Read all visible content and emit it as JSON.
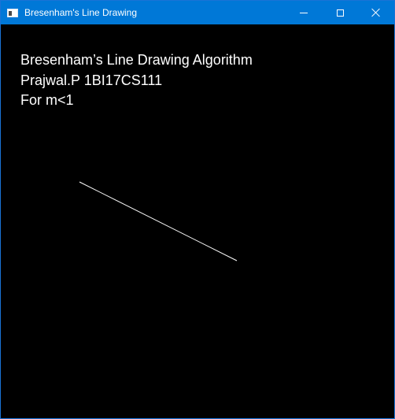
{
  "window": {
    "title": "Bresenham's Line Drawing",
    "titlebar_color": "#0078d7",
    "app_icon": "console-window-icon",
    "controls": {
      "minimize": "minimize-icon",
      "maximize": "maximize-icon",
      "close": "close-icon"
    }
  },
  "canvas": {
    "background": "#000000",
    "text_color": "#ffffff",
    "text_lines": [
      "Bresenham’s Line Drawing Algorithm",
      "Prajwal.P 1BI17CS111",
      "For m<1"
    ],
    "line_color": "#ffffff"
  }
}
